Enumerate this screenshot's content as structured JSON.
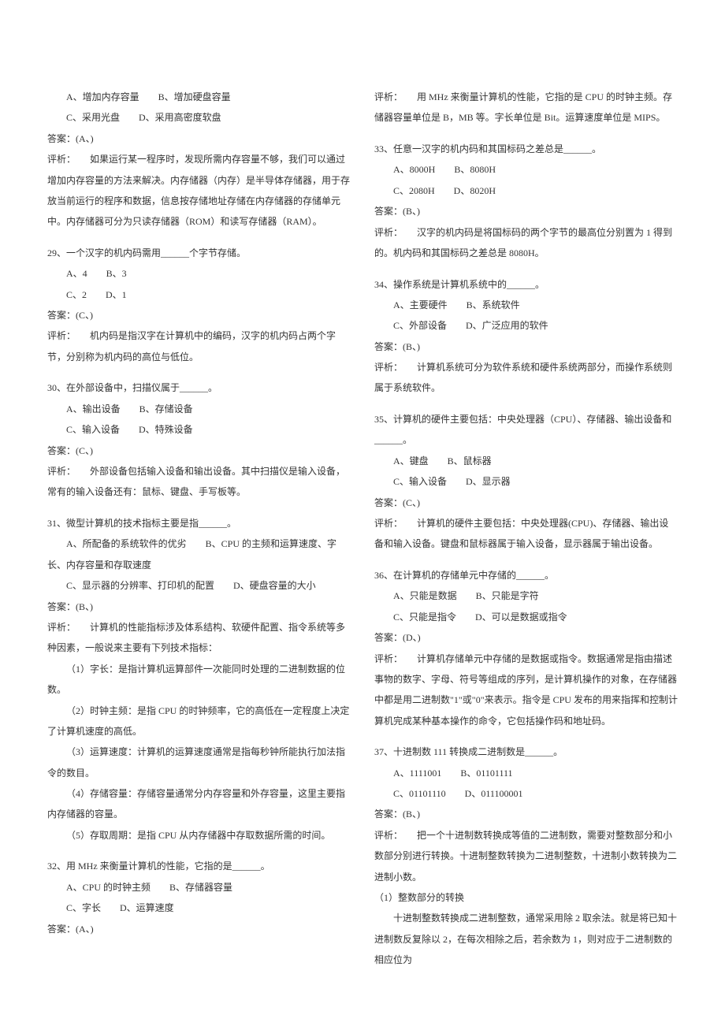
{
  "col1": {
    "q28_opt1": "A、增加内存容量　　B、增加硬盘容量",
    "q28_opt2": "C、采用光盘　　D、采用高密度软盘",
    "q28_ans": "答案：(A、)",
    "q28_exp1": "评析：　　如果运行某一程序时，发现所需内存容量不够，我们可以通过增加内存容量的方法来解决。内存储器（内存）是半导体存储器，用于存放当前运行的程序和数据，信息按存储地址存储在内存储器的存储单元中。内存储器可分为只读存储器（ROM）和读写存储器（RAM）。",
    "q29": "29、一个汉字的机内码需用______个字节存储。",
    "q29_opt1": "A、4　　B、3",
    "q29_opt2": "C、2　　D、1",
    "q29_ans": "答案：(C、)",
    "q29_exp": "评析：　　机内码是指汉字在计算机中的编码，汉字的机内码占两个字节，分别称为机内码的高位与低位。",
    "q30": "30、在外部设备中，扫描仪属于______。",
    "q30_opt1": "A、输出设备　　B、存储设备",
    "q30_opt2": "C、输入设备　　D、特殊设备",
    "q30_ans": "答案：(C、)",
    "q30_exp": "评析：　　外部设备包括输入设备和输出设备。其中扫描仪是输入设备，常有的输入设备还有：鼠标、键盘、手写板等。",
    "q31": "31、微型计算机的技术指标主要是指______。",
    "q31_opt1": "A、所配备的系统软件的优劣　　B、CPU 的主频和运算速度、字长、内存容量和存取速度",
    "q31_opt2": "C、显示器的分辨率、打印机的配置　　D、硬盘容量的大小",
    "q31_ans": "答案：(B、)",
    "q31_exp1": "评析：　　计算机的性能指标涉及体系结构、软硬件配置、指令系统等多种因素，一般说来主要有下列技术指标：",
    "q31_exp2": "（1）字长：是指计算机运算部件一次能同时处理的二进制数据的位数。",
    "q31_exp3": "（2）时钟主频：是指 CPU 的时钟频率，它的高低在一定程度上决定了计算机速度的高低。",
    "q31_exp4": "（3）运算速度：计算机的运算速度通常是指每秒钟所能执行加法指令的数目。",
    "q31_exp5": "（4）存储容量：存储容量通常分内存容量和外存容量，这里主要指内存储器的容量。",
    "q31_exp6": "（5）存取周期：是指 CPU 从内存储器中存取数据所需的时间。",
    "q32": "32、用 MHz 来衡量计算机的性能，它指的是______。",
    "q32_opt1": "A、CPU 的时钟主频　　B、存储器容量",
    "q32_opt2": "C、字长　　D、运算速度",
    "q32_ans": "答案：(A、)"
  },
  "col2": {
    "q32_exp": "评析：　　用 MHz 来衡量计算机的性能，它指的是 CPU 的时钟主频。存储器容量单位是 B，MB 等。字长单位是 Bit。运算速度单位是 MIPS。",
    "q33": "33、任意一汉字的机内码和其国标码之差总是______。",
    "q33_opt1": "A、8000H　　B、8080H",
    "q33_opt2": "C、2080H　　D、8020H",
    "q33_ans": "答案：(B、)",
    "q33_exp": "评析：　　汉字的机内码是将国标码的两个字节的最高位分别置为 1 得到的。机内码和其国标码之差总是 8080H。",
    "q34": "34、操作系统是计算机系统中的______。",
    "q34_opt1": "A、主要硬件　　B、系统软件",
    "q34_opt2": "C、外部设备　　D、广泛应用的软件",
    "q34_ans": "答案：(B、)",
    "q34_exp": "评析：　　计算机系统可分为软件系统和硬件系统两部分，而操作系统则属于系统软件。",
    "q35": "35、计算机的硬件主要包括：中央处理器（CPU）、存储器、输出设备和______。",
    "q35_opt1": "A、键盘　　B、鼠标器",
    "q35_opt2": "C、输入设备　　D、显示器",
    "q35_ans": "答案：(C、)",
    "q35_exp": "评析：　　计算机的硬件主要包括：中央处理器(CPU)、存储器、输出设备和输入设备。键盘和鼠标器属于输入设备，显示器属于输出设备。",
    "q36": "36、在计算机的存储单元中存储的______。",
    "q36_opt1": "A、只能是数据　　B、只能是字符",
    "q36_opt2": "C、只能是指令　　D、可以是数据或指令",
    "q36_ans": "答案：(D、)",
    "q36_exp": "评析：　　计算机存储单元中存储的是数据或指令。数据通常是指由描述事物的数字、字母、符号等组成的序列，是计算机操作的对象，在存储器中都是用二进制数\"1\"或\"0\"来表示。指令是 CPU 发布的用来指挥和控制计算机完成某种基本操作的命令，它包括操作码和地址码。",
    "q37": "37、十进制数 111 转换成二进制数是______。",
    "q37_opt1": "A、1111001　　B、01101111",
    "q37_opt2": "C、01101110　　D、011100001",
    "q37_ans": "答案：(B、)",
    "q37_exp1": "评析：　　把一个十进制数转换成等值的二进制数，需要对整数部分和小数部分别进行转换。十进制整数转换为二进制整数，十进制小数转换为二进制小数。",
    "q37_exp2": "（1）整数部分的转换",
    "q37_exp3": "十进制整数转换成二进制整数，通常采用除 2 取余法。就是将已知十进制数反复除以 2，在每次相除之后，若余数为 1，则对应于二进制数的相应位为"
  }
}
